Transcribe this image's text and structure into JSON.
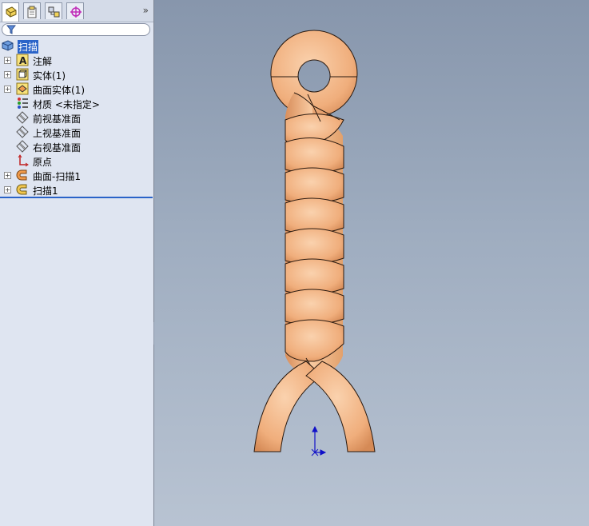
{
  "tabs": [
    {
      "name": "feature-manager",
      "icon": "feature-tree-icon",
      "active": true
    },
    {
      "name": "property-manager",
      "icon": "property-icon",
      "active": false
    },
    {
      "name": "configuration-manager",
      "icon": "configuration-icon",
      "active": false
    },
    {
      "name": "dimxpert-manager",
      "icon": "crosshair-icon",
      "active": false
    }
  ],
  "more_label": "»",
  "tree": {
    "root": {
      "label": "扫描",
      "icon": "part-icon"
    },
    "items": [
      {
        "label": "注解",
        "icon": "annotation-icon",
        "expandable": true
      },
      {
        "label": "实体(1)",
        "icon": "solid-body-icon",
        "expandable": true
      },
      {
        "label": "曲面实体(1)",
        "icon": "surface-body-icon",
        "expandable": true
      },
      {
        "label": "材质 <未指定>",
        "icon": "material-icon",
        "expandable": false
      },
      {
        "label": "前视基准面",
        "icon": "plane-icon",
        "expandable": false
      },
      {
        "label": "上视基准面",
        "icon": "plane-icon",
        "expandable": false
      },
      {
        "label": "右视基准面",
        "icon": "plane-icon",
        "expandable": false
      },
      {
        "label": "原点",
        "icon": "origin-icon",
        "expandable": false
      },
      {
        "label": "曲面-扫描1",
        "icon": "surface-sweep-icon",
        "expandable": true
      },
      {
        "label": "扫描1",
        "icon": "sweep-icon",
        "expandable": true
      }
    ]
  },
  "colors": {
    "model": "#f4b888",
    "model_shade": "#d98f5c",
    "selection": "#2a63c8",
    "triad": "#1010c8"
  }
}
